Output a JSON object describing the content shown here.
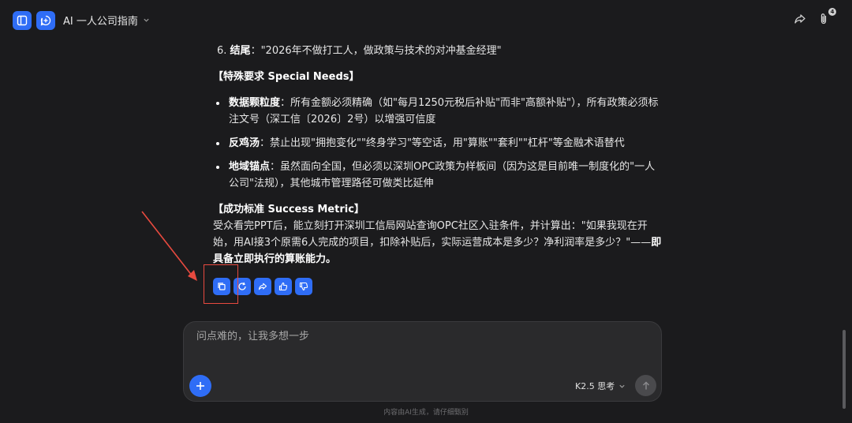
{
  "header": {
    "title": "AI 一人公司指南",
    "attachment_count": "4"
  },
  "content": {
    "item6": {
      "number": "6.",
      "label": "结尾",
      "text": "：\"2026年不做打工人，做政策与技术的对冲基金经理\""
    },
    "special_heading": "【特殊要求 Special Needs】",
    "bullets": [
      {
        "label": "数据颗粒度",
        "text": "：所有金额必须精确（如\"每月1250元税后补贴\"而非\"高额补贴\"），所有政策必须标注文号（深工信〔2026〕2号）以增强可信度"
      },
      {
        "label": "反鸡汤",
        "text": "：禁止出现\"拥抱变化\"\"终身学习\"等空话，用\"算账\"\"套利\"\"杠杆\"等金融术语替代"
      },
      {
        "label": "地域锚点",
        "text": "：虽然面向全国，但必须以深圳OPC政策为样板间（因为这是目前唯一制度化的\"一人公司\"法规），其他城市管理路径可做类比延伸"
      }
    ],
    "success_heading": "【成功标准 Success Metric】",
    "success_text": "受众看完PPT后，能立刻打开深圳工信局网站查询OPC社区入驻条件，并计算出：\"如果我现在开始，用AI接3个原需6人完成的项目，扣除补贴后，实际运营成本是多少？净利润率是多少？\"——",
    "success_bold": "即具备立即执行的算账能力。"
  },
  "composer": {
    "placeholder": "问点难的，让我多想一步",
    "model_label": "K2.5 思考"
  },
  "footer_note": "内容由AI生成，请仔细甄别",
  "colors": {
    "accent": "#2f6df6",
    "annotation": "#e84a3f",
    "background": "#1b1b1d"
  }
}
